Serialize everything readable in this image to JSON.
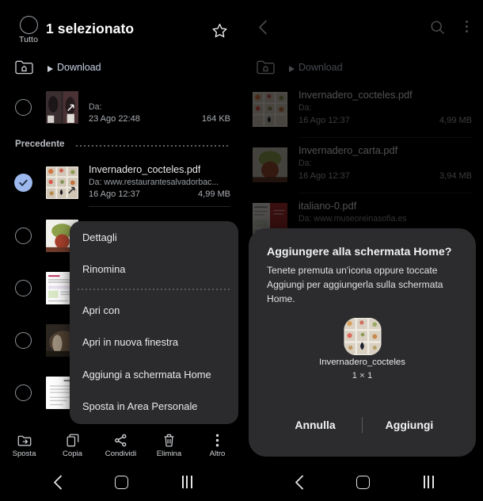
{
  "left_panel": {
    "appbar": {
      "select_all_label": "Tutto",
      "title": "1 selezionato",
      "favorite_icon": "star-icon"
    },
    "breadcrumb": {
      "home_icon": "folder-home-icon",
      "caret_icon": "caret-right-icon",
      "path": "Download"
    },
    "files": [
      {
        "name": "",
        "source_label": "Da:",
        "source": "",
        "date": "23 Ago 22:48",
        "size": "164 KB",
        "selected": false,
        "redacted": true
      },
      {
        "name": "Invernadero_cocteles.pdf",
        "source_label": "Da:",
        "source": "Da: www.restaurantesalvadorbac...",
        "date": "16 Ago 12:37",
        "size": "4,99 MB",
        "selected": true,
        "redacted": false
      }
    ],
    "section_header": "Precedente",
    "context_menu": {
      "items": [
        {
          "label": "Dettagli",
          "separator_after": false
        },
        {
          "label": "Rinomina",
          "separator_after": true
        },
        {
          "label": "Apri con",
          "separator_after": false
        },
        {
          "label": "Apri in nuova finestra",
          "separator_after": false
        },
        {
          "label": "Aggiungi a schermata Home",
          "separator_after": false
        },
        {
          "label": "Sposta in Area Personale",
          "separator_after": false
        }
      ]
    },
    "action_bar": [
      {
        "label": "Sposta",
        "icon": "move-to-folder-icon"
      },
      {
        "label": "Copia",
        "icon": "copy-icon"
      },
      {
        "label": "Condividi",
        "icon": "share-icon"
      },
      {
        "label": "Elimina",
        "icon": "trash-icon"
      },
      {
        "label": "Altro",
        "icon": "more-vertical-icon"
      }
    ],
    "nav_bar": {
      "back": "back-icon",
      "home": "home-icon",
      "recents": "recents-icon"
    }
  },
  "right_panel": {
    "appbar": {
      "back_icon": "back-arrow-icon",
      "search_icon": "search-icon",
      "more_icon": "more-vertical-icon"
    },
    "breadcrumb": {
      "home_icon": "folder-home-icon",
      "caret_icon": "caret-right-icon",
      "path": "Download"
    },
    "files": [
      {
        "name": "Invernadero_cocteles.pdf",
        "source_label": "Da:",
        "source": "",
        "date": "16 Ago 12:37",
        "size": "4,99 MB",
        "redacted": true
      },
      {
        "name": "Invernadero_carta.pdf",
        "source_label": "Da:",
        "source": "",
        "date": "16 Ago 12:37",
        "size": "3,94 MB",
        "redacted": true
      },
      {
        "name": "italiano-0.pdf",
        "source_label": "Da:",
        "source": "Da: www.museoreinasofia.es",
        "date": "",
        "size": "",
        "redacted": false
      }
    ],
    "dialog": {
      "title": "Aggiungere alla schermata Home?",
      "body": "Tenete premuta un'icona oppure toccate Aggiungi per aggiungerla sulla schermata Home.",
      "widget_name": "Invernadero_cocteles",
      "widget_size": "1 × 1",
      "cancel_label": "Annulla",
      "confirm_label": "Aggiungi"
    },
    "nav_bar": {
      "back": "back-icon",
      "home": "home-icon",
      "recents": "recents-icon"
    }
  },
  "colors": {
    "background": "#000000",
    "surface": "#2b2b2d",
    "dialog_surface": "#2c2c2e",
    "accent_check": "#9cb8ec",
    "breadcrumb_link": "#c8d2e4",
    "primary_text": "#e9eaec",
    "secondary_text": "#9a9ea3"
  }
}
